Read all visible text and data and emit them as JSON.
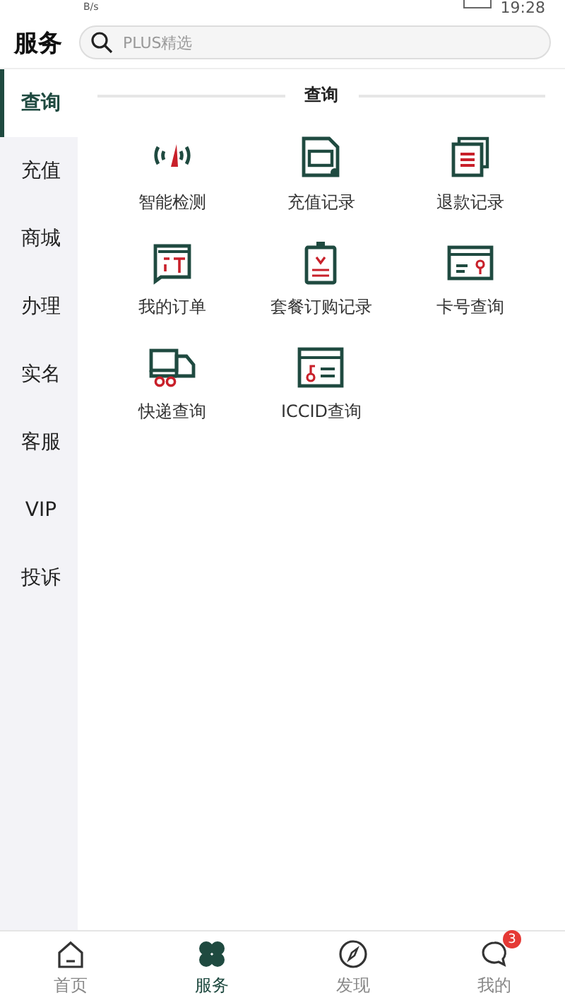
{
  "status_bar": {
    "speed": "B/s",
    "time": "19:28"
  },
  "header": {
    "title": "服务",
    "search": {
      "placeholder": "PLUS精选"
    }
  },
  "sidebar": {
    "items": [
      {
        "label": "查询",
        "selected": true
      },
      {
        "label": "充值",
        "selected": false
      },
      {
        "label": "商城",
        "selected": false
      },
      {
        "label": "办理",
        "selected": false
      },
      {
        "label": "实名",
        "selected": false
      },
      {
        "label": "客服",
        "selected": false
      },
      {
        "label": "VIP",
        "selected": false
      },
      {
        "label": "投诉",
        "selected": false
      }
    ]
  },
  "section": {
    "title": "查询",
    "items": [
      {
        "label": "智能检测"
      },
      {
        "label": "充值记录"
      },
      {
        "label": "退款记录"
      },
      {
        "label": "我的订单"
      },
      {
        "label": "套餐订购记录"
      },
      {
        "label": "卡号查询"
      },
      {
        "label": "快递查询"
      },
      {
        "label": "ICCID查询"
      }
    ]
  },
  "tab_bar": {
    "tabs": [
      {
        "label": "首页",
        "selected": false
      },
      {
        "label": "服务",
        "selected": true
      },
      {
        "label": "发现",
        "selected": false
      },
      {
        "label": "我的",
        "selected": false,
        "badge": "3"
      }
    ]
  }
}
